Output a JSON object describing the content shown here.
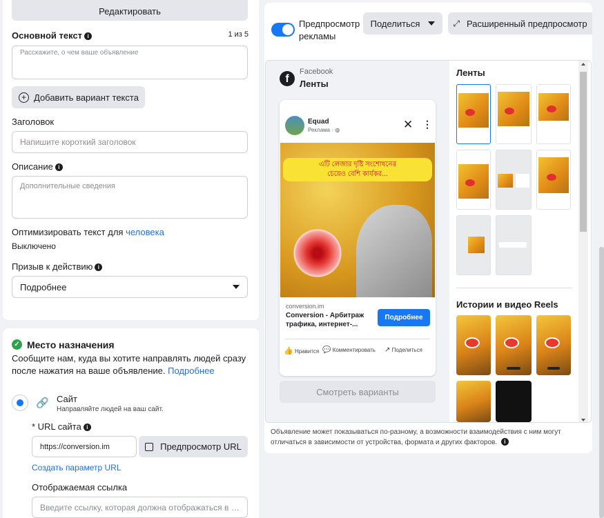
{
  "left": {
    "edit_button": "Редактировать",
    "primary_text": {
      "label": "Основной текст",
      "counter": "1 из 5",
      "placeholder": "Расскажите, о чем ваше объявление"
    },
    "add_variant": "Добавить вариант текста",
    "headline": {
      "label": "Заголовок",
      "placeholder": "Напишите короткий заголовок"
    },
    "description": {
      "label": "Описание",
      "placeholder": "Дополнительные сведения"
    },
    "optimize": {
      "label": "Оптимизировать текст для",
      "link": "человека",
      "status": "Выключено"
    },
    "cta": {
      "label": "Призыв к действию",
      "value": "Подробнее"
    },
    "destination": {
      "title": "Место назначения",
      "desc": "Сообщите нам, куда вы хотите направлять людей сразу после нажатия на ваше объявление.",
      "more": "Подробнее",
      "site_title": "Сайт",
      "site_sub": "Направляйте людей на ваш сайт.",
      "url_label": "* URL сайта",
      "url_value": "https://conversion.im",
      "preview_url": "Предпросмотр URL",
      "create_param": "Создать параметр URL",
      "display_link_label": "Отображаемая ссылка",
      "display_link_placeholder": "Введите ссылку, которая должна отображаться в вашем объявлении"
    }
  },
  "right": {
    "preview_toggle": "Предпросмотр рекламы",
    "share": "Поделиться",
    "advanced_preview": "Расширенный предпросмотр",
    "platform": "Facebook",
    "placement": "Ленты",
    "ad": {
      "page_name": "Equad",
      "sponsored": "Реклама · ",
      "domain": "conversion.im",
      "title": "Conversion - Арбитраж трафика, интернет-...",
      "cta": "Подробнее",
      "banner_text_1": "এটি লেজার দৃষ্টি সংশোধনের",
      "banner_text_2": "চেয়েও বেশি কার্যকর...",
      "like": "Нравится",
      "comment": "Комментировать",
      "share": "Поделиться"
    },
    "see_variants": "Смотреть варианты",
    "feeds_title": "Ленты",
    "stories_title": "Истории и видео Reels",
    "disclaimer": "Объявление может показываться по-разному, а возможности взаимодействия с ним могут отличаться в зависимости от устройства, формата и других факторов."
  },
  "colors": {
    "accent": "#1877f2",
    "link": "#216fdb",
    "success": "#31a24c"
  }
}
